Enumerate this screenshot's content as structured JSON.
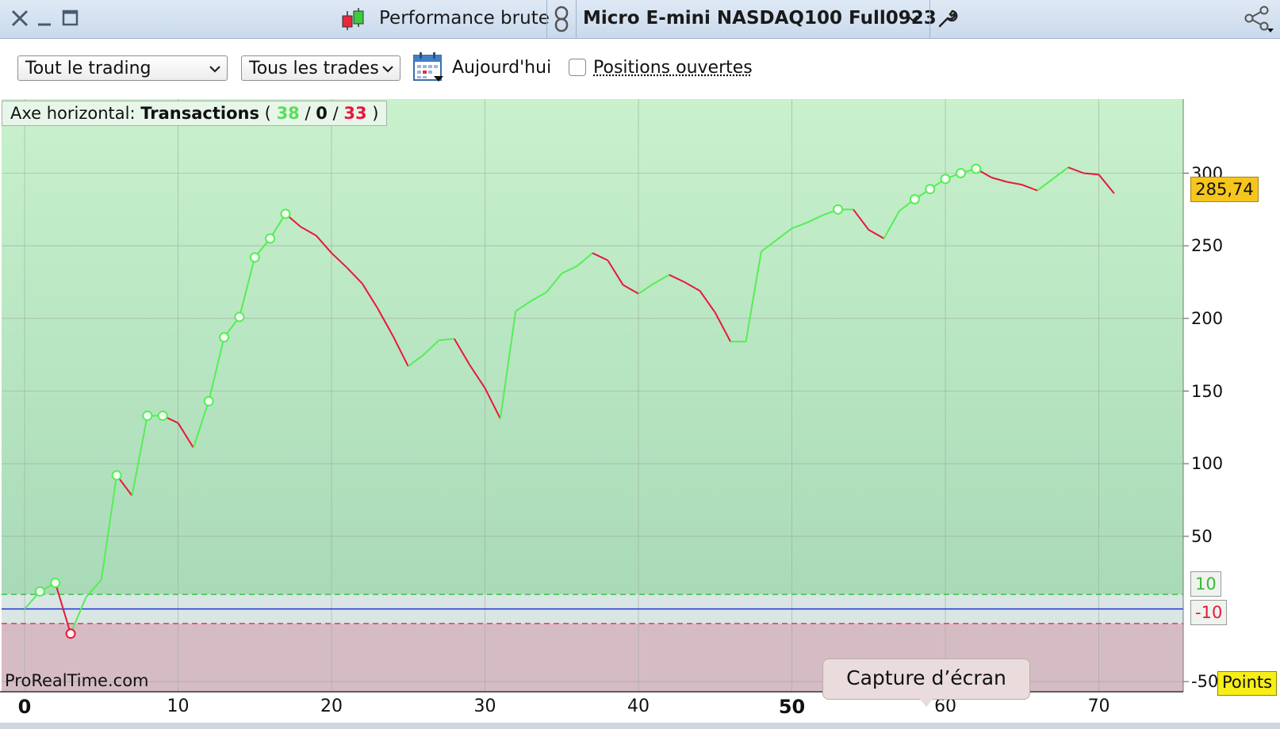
{
  "window": {
    "title": "Performance brute",
    "instrument": "Micro E-mini NASDAQ100 Full0923"
  },
  "toolbar": {
    "scope_select": "Tout le trading",
    "trades_select": "Tous les trades",
    "today_label": "Aujourd'hui",
    "open_positions_label": "Positions ouvertes",
    "open_positions_checked": false
  },
  "legend": {
    "prefix": "Axe horizontal:",
    "axis_name": "Transactions",
    "open_paren": "(",
    "sep": "/",
    "close_paren": ")",
    "winners": "38",
    "neutral": "0",
    "losers": "33"
  },
  "watermark": "ProRealTime.com",
  "tooltip": "Capture d’écran",
  "units_badge": "Points",
  "last_value_label": "285,74",
  "zone_labels": {
    "upper": "10",
    "lower": "-10"
  },
  "colors": {
    "up": "#55ee55",
    "down": "#e8173a",
    "zero_line": "#1c2fd6",
    "upper_zone_top": "#c8f1cc",
    "upper_zone_bottom": "#a9dab8",
    "lower_zone": "#d5bcc4"
  },
  "chart_data": {
    "type": "line",
    "xlabel": "",
    "ylabel": "",
    "xlim": [
      -1.5,
      75.5
    ],
    "ylim": [
      -57,
      351
    ],
    "x_ticks": [
      0,
      10,
      20,
      30,
      40,
      50,
      60,
      70
    ],
    "x_ticks_bold": [
      0,
      50
    ],
    "y_ticks": [
      300,
      250,
      200,
      150,
      100,
      50,
      -50
    ],
    "zero_line": 0,
    "zone_upper": 10,
    "zone_lower": -10,
    "last_value": 285.74,
    "grid": true,
    "x": [
      0,
      1,
      2,
      3,
      4,
      5,
      6,
      7,
      8,
      9,
      10,
      11,
      12,
      13,
      14,
      15,
      16,
      17,
      18,
      19,
      20,
      21,
      22,
      23,
      24,
      25,
      26,
      27,
      28,
      29,
      30,
      31,
      32,
      33,
      34,
      35,
      36,
      37,
      38,
      39,
      40,
      41,
      42,
      43,
      44,
      45,
      46,
      47,
      48,
      49,
      50,
      51,
      52,
      53,
      54,
      55,
      56,
      57,
      58,
      59,
      60,
      61,
      62,
      63,
      64,
      65,
      66,
      67,
      68,
      69,
      70,
      71
    ],
    "values": [
      0,
      12,
      18,
      -17,
      8,
      20,
      92,
      78,
      133,
      133,
      128,
      111,
      143,
      187,
      201,
      242,
      255,
      272,
      263,
      257,
      245,
      235,
      224,
      207,
      188,
      167,
      175,
      185,
      186,
      168,
      152,
      131,
      205,
      212,
      218,
      231,
      236,
      245,
      240,
      223,
      217,
      224,
      230,
      225,
      219,
      204,
      184,
      184,
      246,
      254,
      262,
      266,
      271,
      275,
      275,
      261,
      255,
      274,
      282,
      289,
      296,
      300,
      303,
      297,
      294,
      292,
      288,
      296,
      304,
      300,
      299,
      286
    ],
    "new_high_markers": [
      1,
      2,
      6,
      8,
      9,
      12,
      13,
      14,
      15,
      16,
      17,
      53,
      58,
      59,
      60,
      61,
      62
    ],
    "new_low_markers": [
      3
    ]
  }
}
